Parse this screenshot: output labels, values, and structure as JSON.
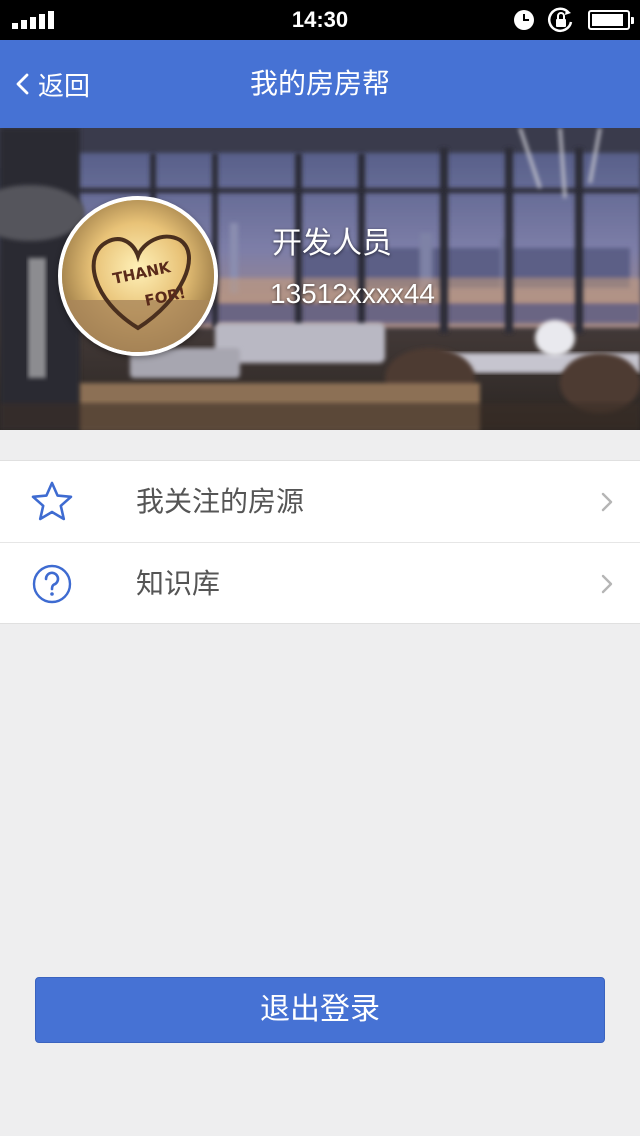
{
  "status_bar": {
    "time": "14:30",
    "signal_icon": "signal-bars-icon",
    "icons": [
      "alarm-clock-icon",
      "rotation-lock-icon",
      "battery-icon"
    ],
    "battery_level": 0.9
  },
  "nav": {
    "back_label": "返回",
    "back_icon": "chevron-left-icon",
    "title": "我的房房帮"
  },
  "profile": {
    "name": "开发人员",
    "phone": "13512xxxx44",
    "avatar_text": "THANK FOR!",
    "background": "blurred living room with city-view windows"
  },
  "menu": {
    "items": [
      {
        "label": "我关注的房源",
        "icon": "star-icon"
      },
      {
        "label": "知识库",
        "icon": "question-circle-icon"
      }
    ],
    "chevron_icon": "chevron-right-icon"
  },
  "logout": {
    "label": "退出登录"
  },
  "colors": {
    "accent": "#4672d4",
    "background": "#eeeeef",
    "menu_text": "#555555",
    "icon_blue": "#3e6bd1"
  }
}
